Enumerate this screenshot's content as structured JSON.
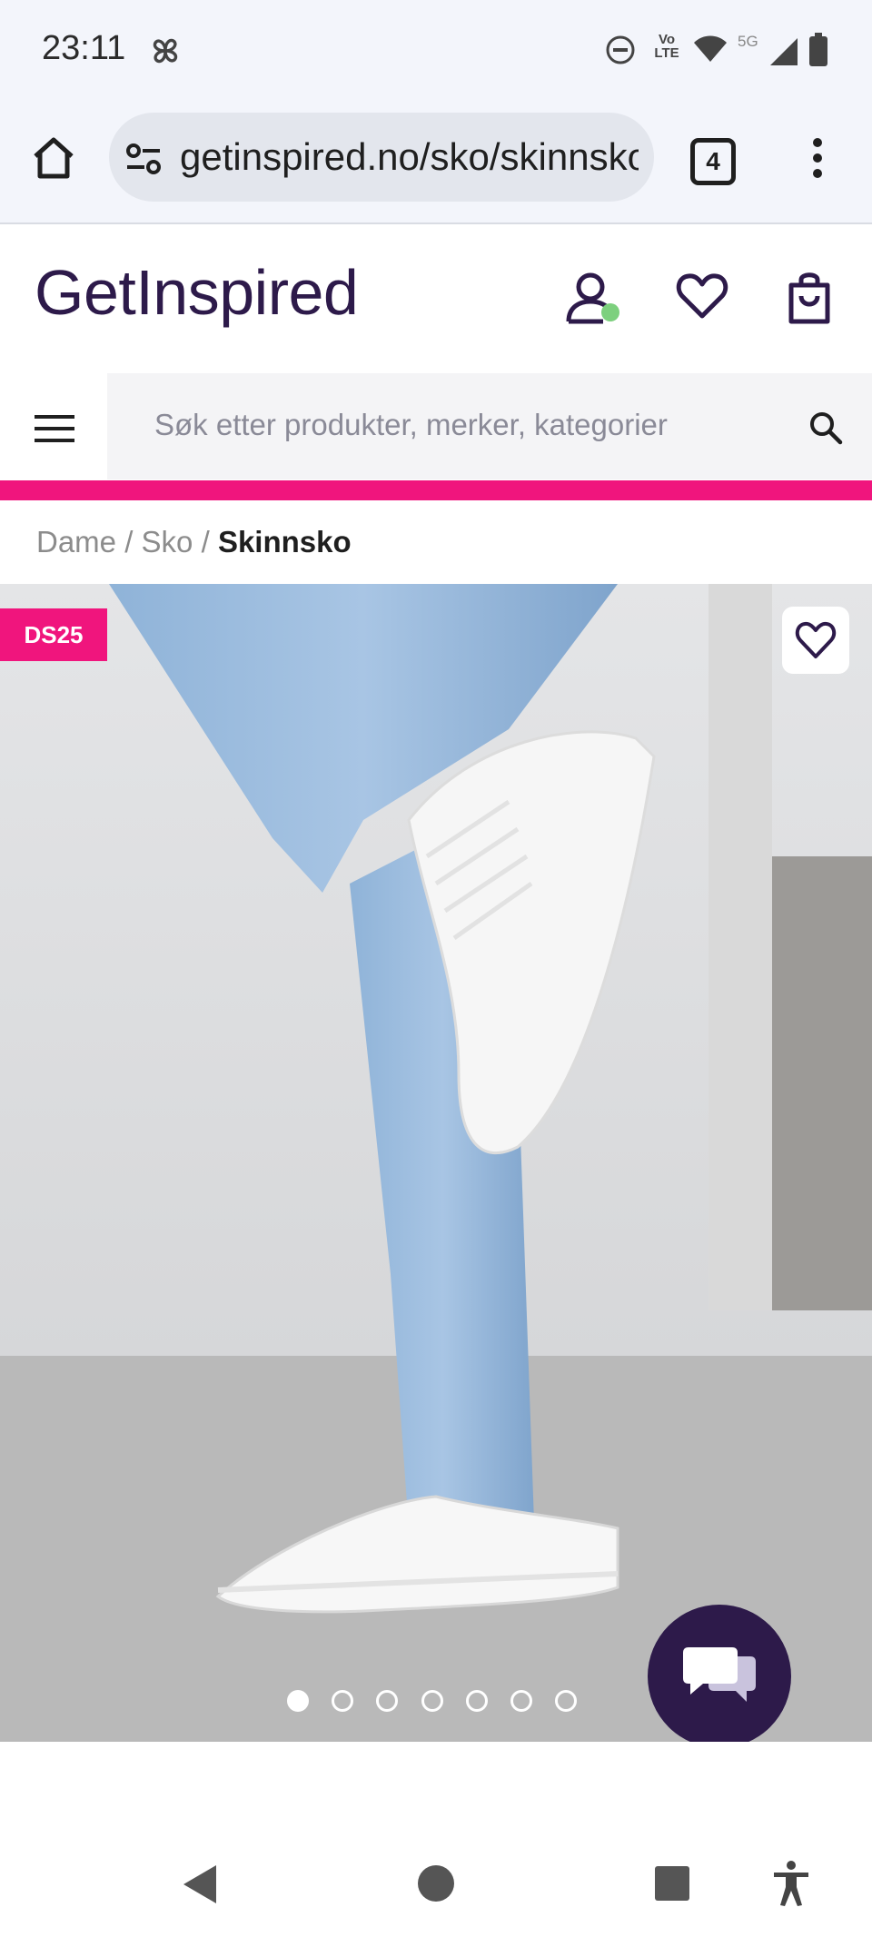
{
  "status_bar": {
    "time": "23:11",
    "icons": [
      "pinwheel-icon",
      "do-not-disturb-icon",
      "volte-icon",
      "wifi-icon",
      "5g-icon",
      "signal-icon",
      "battery-icon"
    ],
    "network": "5G",
    "volte": "Vo LTE"
  },
  "browser": {
    "url": "getinspired.no/sko/skinnsko",
    "tab_count": "4"
  },
  "site": {
    "logo": "GetInspired",
    "search_placeholder": "Søk etter produkter, merker, kategorier",
    "accent_color": "#f0157d",
    "brand_color": "#2d1a4a"
  },
  "breadcrumb": {
    "items": [
      "Dame",
      "Sko"
    ],
    "separator": "/",
    "current": "Skinnsko"
  },
  "product": {
    "badge": "DS25",
    "image_count": 7,
    "active_image": 1
  }
}
